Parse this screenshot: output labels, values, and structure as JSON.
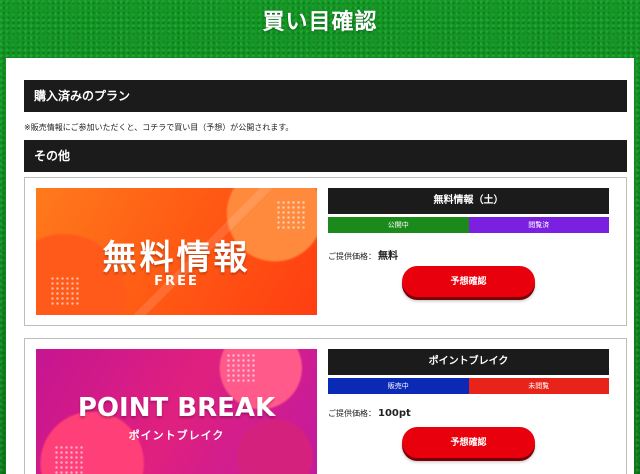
{
  "header": {
    "title": "買い目確認"
  },
  "sections": {
    "purchased": {
      "label": "購入済みのプラン"
    },
    "notice": "※販売情報にご参加いただくと、コチラで買い目（予想）が公開されます。",
    "other": {
      "label": "その他"
    }
  },
  "price_label": "ご提供価格：",
  "cards": [
    {
      "banner": {
        "title": "無料情報",
        "subtitle": "FREE",
        "colors": [
          "#ff7a1c",
          "#ff3e12"
        ]
      },
      "title": "無料情報（土）",
      "statuses": [
        {
          "label": "公開中",
          "color": "#1a8a1a"
        },
        {
          "label": "閲覧済",
          "color": "#7b1fe0"
        }
      ],
      "price": "無料",
      "button_label": "予想確認"
    },
    {
      "banner": {
        "title": "POINT BREAK",
        "subtitle": "ポイントブレイク",
        "colors": [
          "#c51592",
          "#e0207e"
        ]
      },
      "title": "ポイントブレイク",
      "statuses": [
        {
          "label": "販売中",
          "color": "#0a2ab5"
        },
        {
          "label": "未閲覧",
          "color": "#e8241a"
        }
      ],
      "price": "100pt",
      "button_label": "予想確認"
    }
  ]
}
